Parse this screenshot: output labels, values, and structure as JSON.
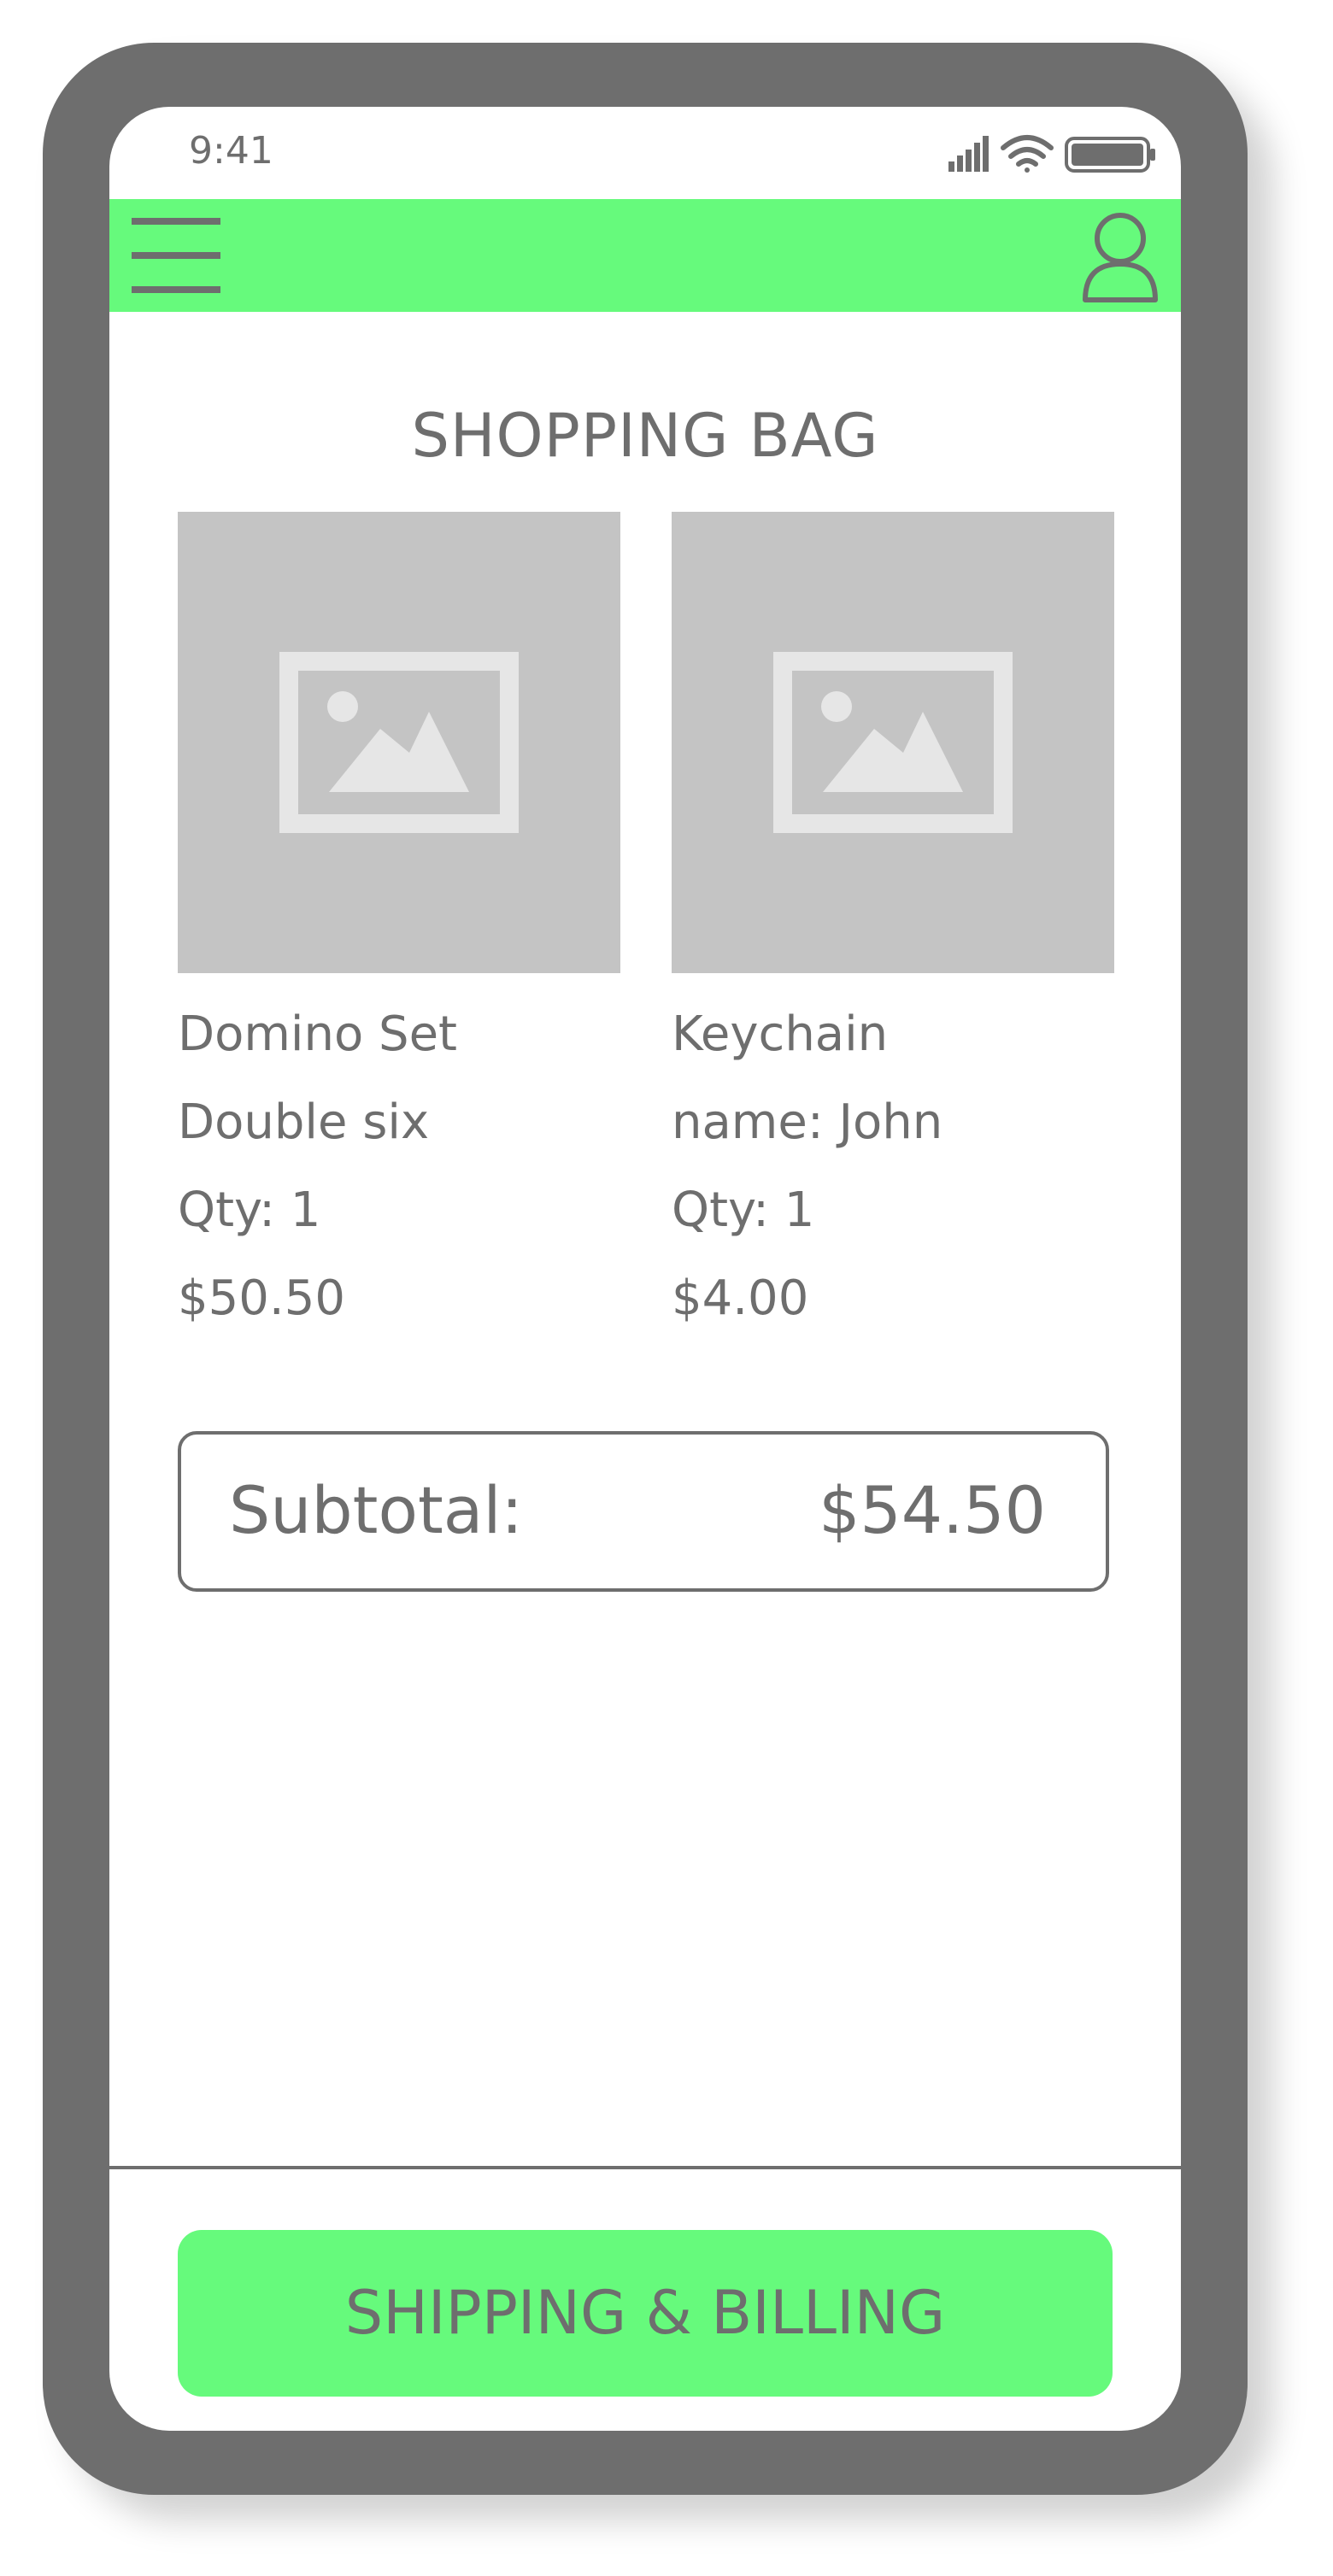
{
  "status_bar": {
    "time": "9:41",
    "icons": [
      "signal-icon",
      "wifi-icon",
      "battery-icon"
    ]
  },
  "nav": {
    "menu_icon": "hamburger-menu-icon",
    "profile_icon": "user-profile-icon"
  },
  "page": {
    "title": "SHOPPING BAG"
  },
  "products": [
    {
      "name": "Domino Set",
      "option": "Double six",
      "qty": "Qty: 1",
      "price": "$50.50",
      "image_icon": "image-placeholder-icon"
    },
    {
      "name": "Keychain",
      "option": "name: John",
      "qty": "Qty: 1",
      "price": "$4.00",
      "image_icon": "image-placeholder-icon"
    }
  ],
  "subtotal": {
    "label": "Subtotal:",
    "value": "$54.50"
  },
  "cta": {
    "label": "SHIPPING & BILLING"
  },
  "colors": {
    "accent": "#66fa7c",
    "text": "#6e6e6e",
    "frame": "#6e6e6e",
    "placeholder": "#c4c4c4"
  }
}
